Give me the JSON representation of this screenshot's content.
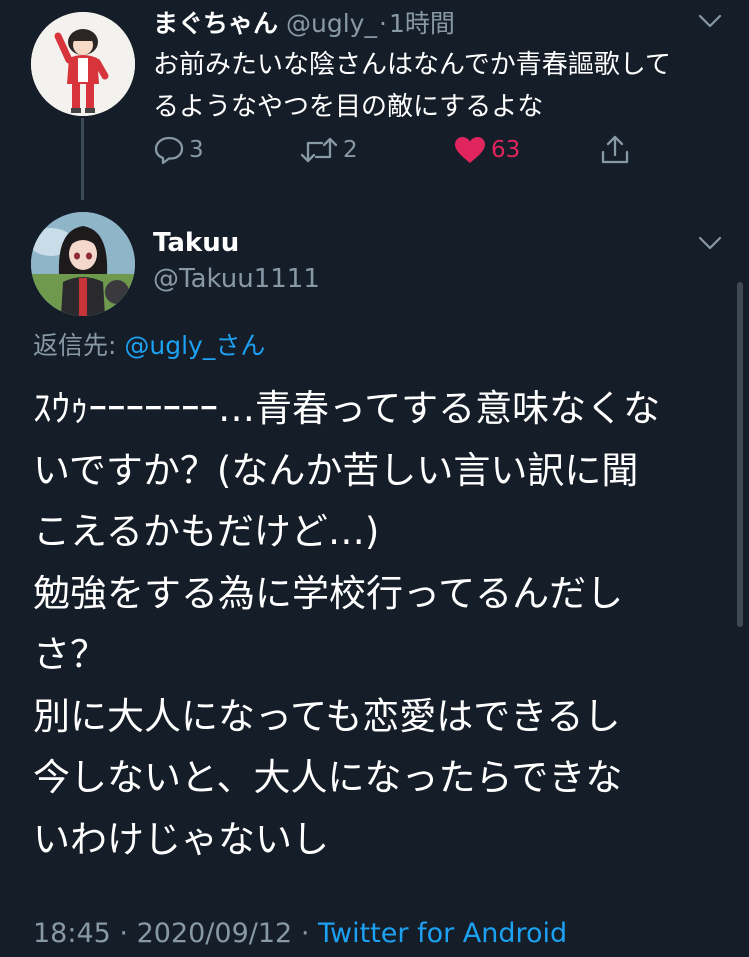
{
  "tweet1": {
    "name": "まぐちゃん",
    "handle": "@ugly_",
    "separator": "·",
    "time": "1時間",
    "text_lines": [
      "お前みたいな陰さんはなんでか青春謳歌して",
      "るようなやつを目の敵にするよな"
    ],
    "actions": {
      "reply_count": "3",
      "retweet_count": "2",
      "like_count": "63",
      "liked": true
    }
  },
  "tweet2": {
    "name": "Takuu",
    "handle": "@Takuu1111",
    "reply_label": "返信先:",
    "reply_mention": "@ugly_さん",
    "text_lines": [
      "ｽｳｩｰｰｰｰｰｰｰ…青春ってする意味なくな",
      "いですか？(なんか苦しい言い訳に聞",
      "こえるかもだけど…)",
      "勉強をする為に学校行ってるんだし",
      "さ？",
      "別に大人になっても恋愛はできるし",
      "今しないと、大人になったらできな",
      "いわけじゃないし"
    ],
    "footer_time": "18:45",
    "footer_sep1": "·",
    "footer_date": "2020/09/12",
    "footer_sep2": "·",
    "footer_client": "Twitter for Android"
  },
  "colors": {
    "background": "#151d28",
    "secondary_text": "#8899a6",
    "link": "#1da1f2",
    "like": "#e0245e"
  },
  "icons": {
    "reply": "speech-bubble-icon",
    "retweet": "retweet-arrows-icon",
    "like": "heart-icon",
    "share": "share-upload-icon",
    "more": "chevron-down-icon"
  }
}
